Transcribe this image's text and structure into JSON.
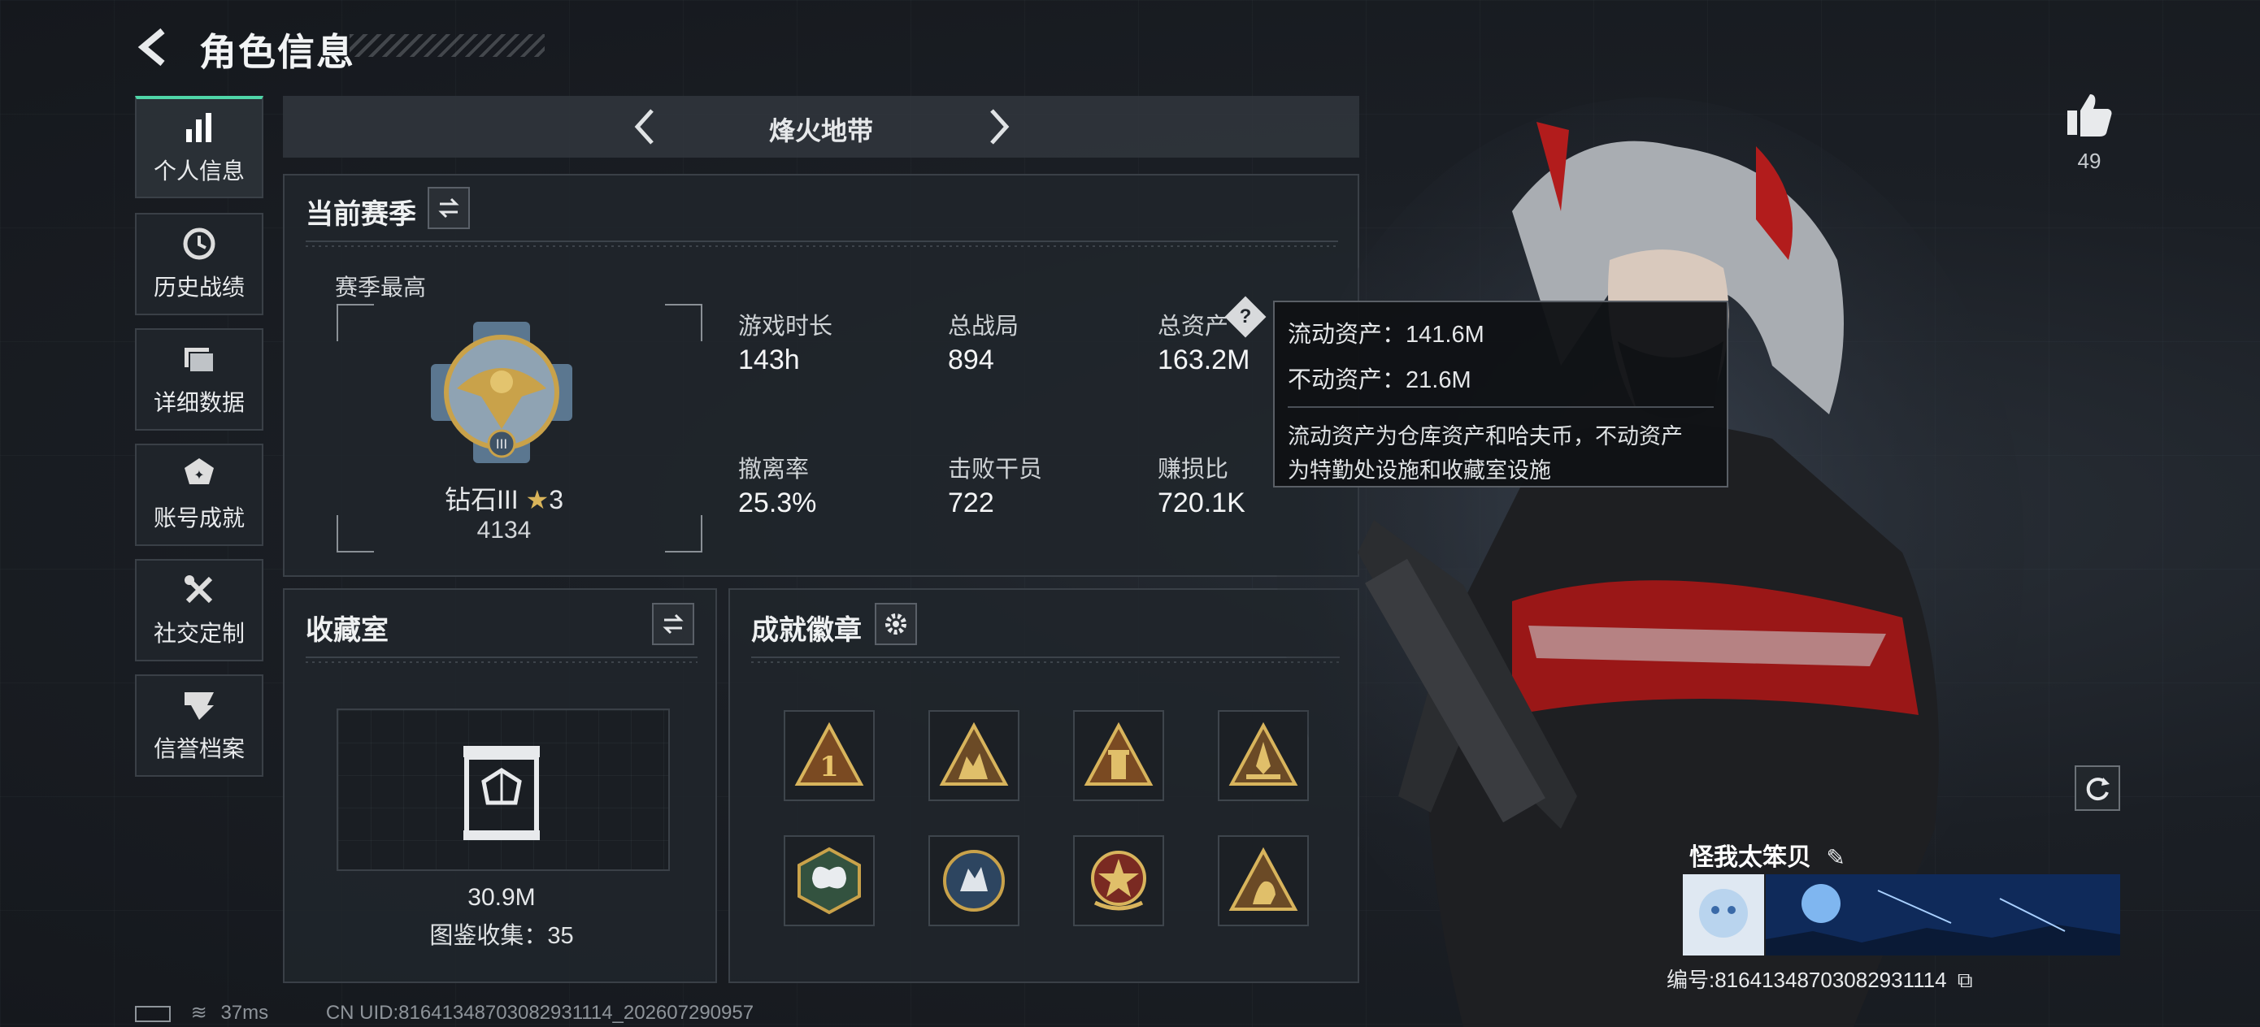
{
  "header": {
    "title": "角色信息"
  },
  "sidebar": {
    "items": [
      {
        "label": "个人信息",
        "icon": "bar-chart-icon",
        "active": true
      },
      {
        "label": "历史战绩",
        "icon": "history-icon"
      },
      {
        "label": "详细数据",
        "icon": "folder-icon"
      },
      {
        "label": "账号成就",
        "icon": "achievement-icon"
      },
      {
        "label": "社交定制",
        "icon": "tools-icon"
      },
      {
        "label": "信誉档案",
        "icon": "reputation-icon"
      }
    ]
  },
  "mode": {
    "name": "烽火地带"
  },
  "season": {
    "title": "当前赛季",
    "best_label": "赛季最高",
    "rank_name": "钻石III",
    "rank_stars": "3",
    "rank_score": "4134",
    "stats": [
      {
        "label": "游戏时长",
        "value": "143h"
      },
      {
        "label": "总战局",
        "value": "894"
      },
      {
        "label": "总资产",
        "value": "163.2M"
      },
      {
        "label": "撤离率",
        "value": "25.3%"
      },
      {
        "label": "击败干员",
        "value": "722"
      },
      {
        "label": "赚损比",
        "value": "720.1K"
      }
    ]
  },
  "tooltip": {
    "liquid": "流动资产：141.6M",
    "fixed": "不动资产：21.6M",
    "desc_line1": "流动资产为仓库资产和哈夫币，不动资产",
    "desc_line2": "为特勤处设施和收藏室设施"
  },
  "collection": {
    "title": "收藏室",
    "value": "30.9M",
    "count": "图鉴收集：35"
  },
  "badges": {
    "title": "成就徽章",
    "items": [
      "badge-1-icon",
      "badge-soldiers-icon",
      "badge-tower-icon",
      "badge-rocket-icon",
      "badge-butterfly-icon",
      "badge-wolf-icon",
      "badge-star-icon",
      "badge-runner-icon"
    ]
  },
  "profile": {
    "likes": "49",
    "player_name": "怪我太笨贝",
    "player_id": "编号:8164134870308293111​4"
  },
  "status": {
    "ping": "37ms",
    "uid": "CN UID:8164134870308293111​4_202607290957"
  },
  "colors": {
    "accent": "#4fd6a8",
    "gold": "#c9a24a",
    "panel": "#20252b"
  }
}
